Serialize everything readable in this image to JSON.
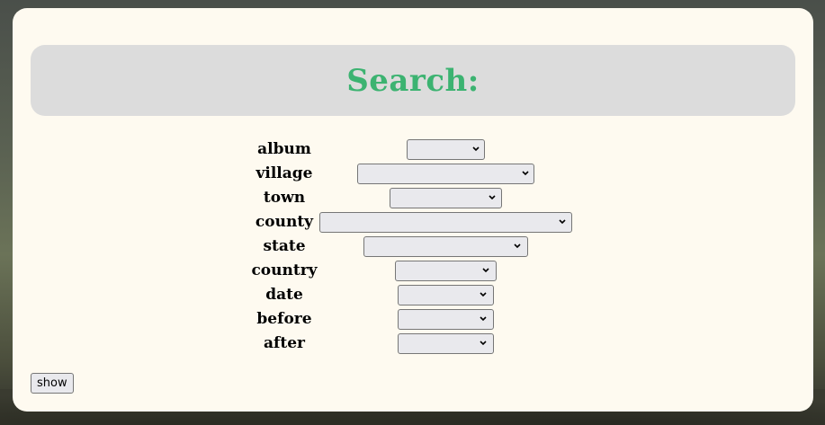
{
  "page": {
    "title": "Search:",
    "fields": [
      {
        "id": "album",
        "label": "album",
        "value": ""
      },
      {
        "id": "village",
        "label": "village",
        "value": ""
      },
      {
        "id": "town",
        "label": "town",
        "value": ""
      },
      {
        "id": "county",
        "label": "county",
        "value": ""
      },
      {
        "id": "state",
        "label": "state",
        "value": ""
      },
      {
        "id": "country",
        "label": "country",
        "value": ""
      },
      {
        "id": "date",
        "label": "date",
        "value": ""
      },
      {
        "id": "before",
        "label": "before",
        "value": ""
      },
      {
        "id": "after",
        "label": "after",
        "value": ""
      }
    ],
    "show_label": "show"
  },
  "colors": {
    "title": "#3cb371",
    "panel": "#fefaf0",
    "banner": "#dcdcdc"
  },
  "icons": {
    "select_chevron": "chevron-down-icon"
  }
}
